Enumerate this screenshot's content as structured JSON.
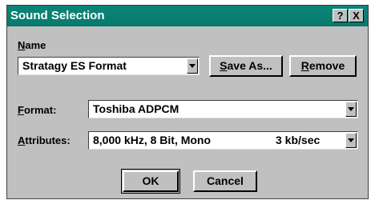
{
  "window": {
    "title": "Sound Selection",
    "help_label": "?",
    "close_label": "X"
  },
  "name_section": {
    "label_prefix": "",
    "label_underlined": "N",
    "label_rest": "ame",
    "value": "Stratagy ES Format"
  },
  "buttons": {
    "save_as_underlined": "S",
    "save_as_rest": "ave As...",
    "remove_underlined": "R",
    "remove_rest": "emove",
    "ok": "OK",
    "cancel": "Cancel"
  },
  "format": {
    "label_underlined": "F",
    "label_rest": "ormat:",
    "value": "Toshiba ADPCM"
  },
  "attributes": {
    "label_underlined": "A",
    "label_rest": "ttributes:",
    "value": "8,000 kHz, 8 Bit, Mono",
    "rate": "3 kb/sec"
  },
  "colors": {
    "titlebar": "#0b8578",
    "dialog_bg": "#c0c0c0"
  }
}
